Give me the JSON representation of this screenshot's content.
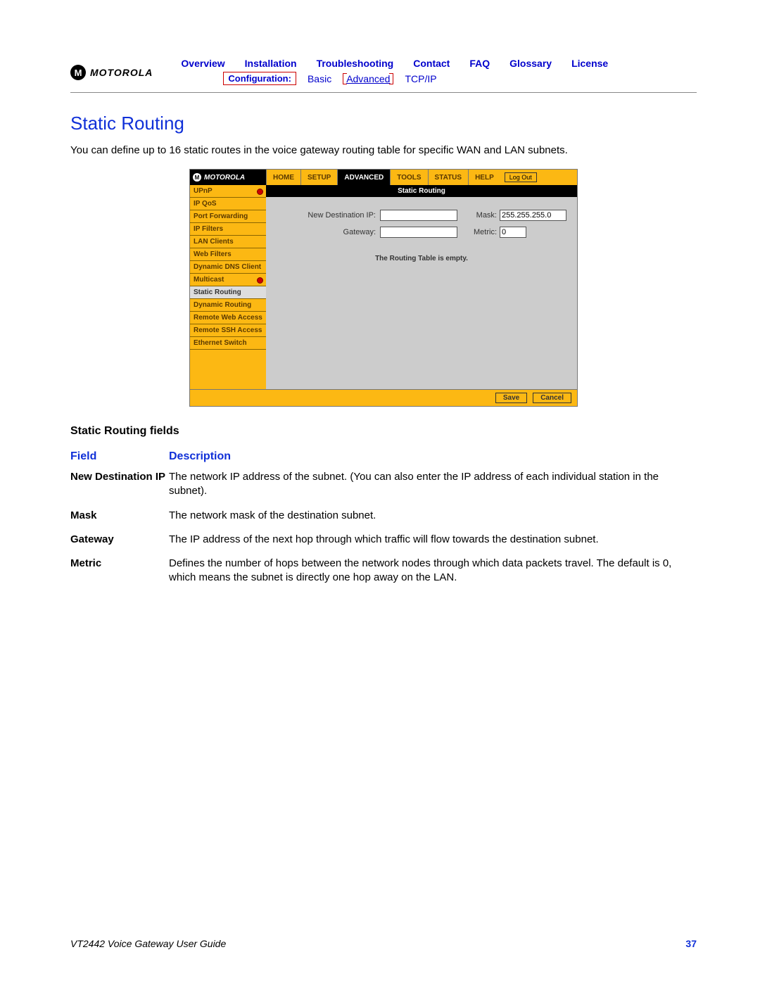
{
  "header": {
    "brand": "MOTOROLA",
    "nav": [
      "Overview",
      "Installation",
      "Troubleshooting",
      "Contact",
      "FAQ",
      "Glossary",
      "License"
    ],
    "subnav": {
      "label": "Configuration:",
      "items": [
        "Basic",
        "Advanced",
        "TCP/IP"
      ]
    }
  },
  "section": {
    "title": "Static Routing",
    "intro": "You can define up to 16 static routes in the voice gateway routing table for specific WAN and LAN subnets."
  },
  "router_ui": {
    "brand": "MOTOROLA",
    "tabs": [
      "HOME",
      "SETUP",
      "ADVANCED",
      "TOOLS",
      "STATUS",
      "HELP"
    ],
    "active_tab": "ADVANCED",
    "logout": "Log Out",
    "sidebar": [
      {
        "label": "UPnP",
        "dot": true
      },
      {
        "label": "IP QoS"
      },
      {
        "label": "Port Forwarding"
      },
      {
        "label": "IP Filters"
      },
      {
        "label": "LAN Clients"
      },
      {
        "label": "Web Filters"
      },
      {
        "label": "Dynamic DNS Client"
      },
      {
        "label": "Multicast",
        "dot": true
      },
      {
        "label": "Static Routing",
        "selected": true
      },
      {
        "label": "Dynamic Routing"
      },
      {
        "label": "Remote Web Access"
      },
      {
        "label": "Remote SSH Access"
      },
      {
        "label": "Ethernet Switch"
      }
    ],
    "panel_title": "Static Routing",
    "fields": {
      "dest_label": "New Destination IP:",
      "dest_value": "",
      "mask_label": "Mask:",
      "mask_value": "255.255.255.0",
      "gw_label": "Gateway:",
      "gw_value": "",
      "metric_label": "Metric:",
      "metric_value": "0"
    },
    "empty_msg": "The Routing Table is empty.",
    "save": "Save",
    "cancel": "Cancel"
  },
  "fields_section": {
    "heading": "Static Routing fields",
    "col_field": "Field",
    "col_desc": "Description",
    "rows": [
      {
        "f": "New Destination IP",
        "d": "The network IP address of the subnet. (You can also enter the IP address of each individual station in the subnet)."
      },
      {
        "f": "Mask",
        "d": "The network mask of the destination subnet."
      },
      {
        "f": "Gateway",
        "d": "The IP address of the next hop through which traffic will flow towards the destination subnet."
      },
      {
        "f": "Metric",
        "d": "Defines the number of hops between the network nodes through which data packets travel. The default is 0, which means the subnet is directly one hop away on the LAN."
      }
    ]
  },
  "footer": {
    "guide": "VT2442 Voice Gateway User Guide",
    "page": "37"
  }
}
